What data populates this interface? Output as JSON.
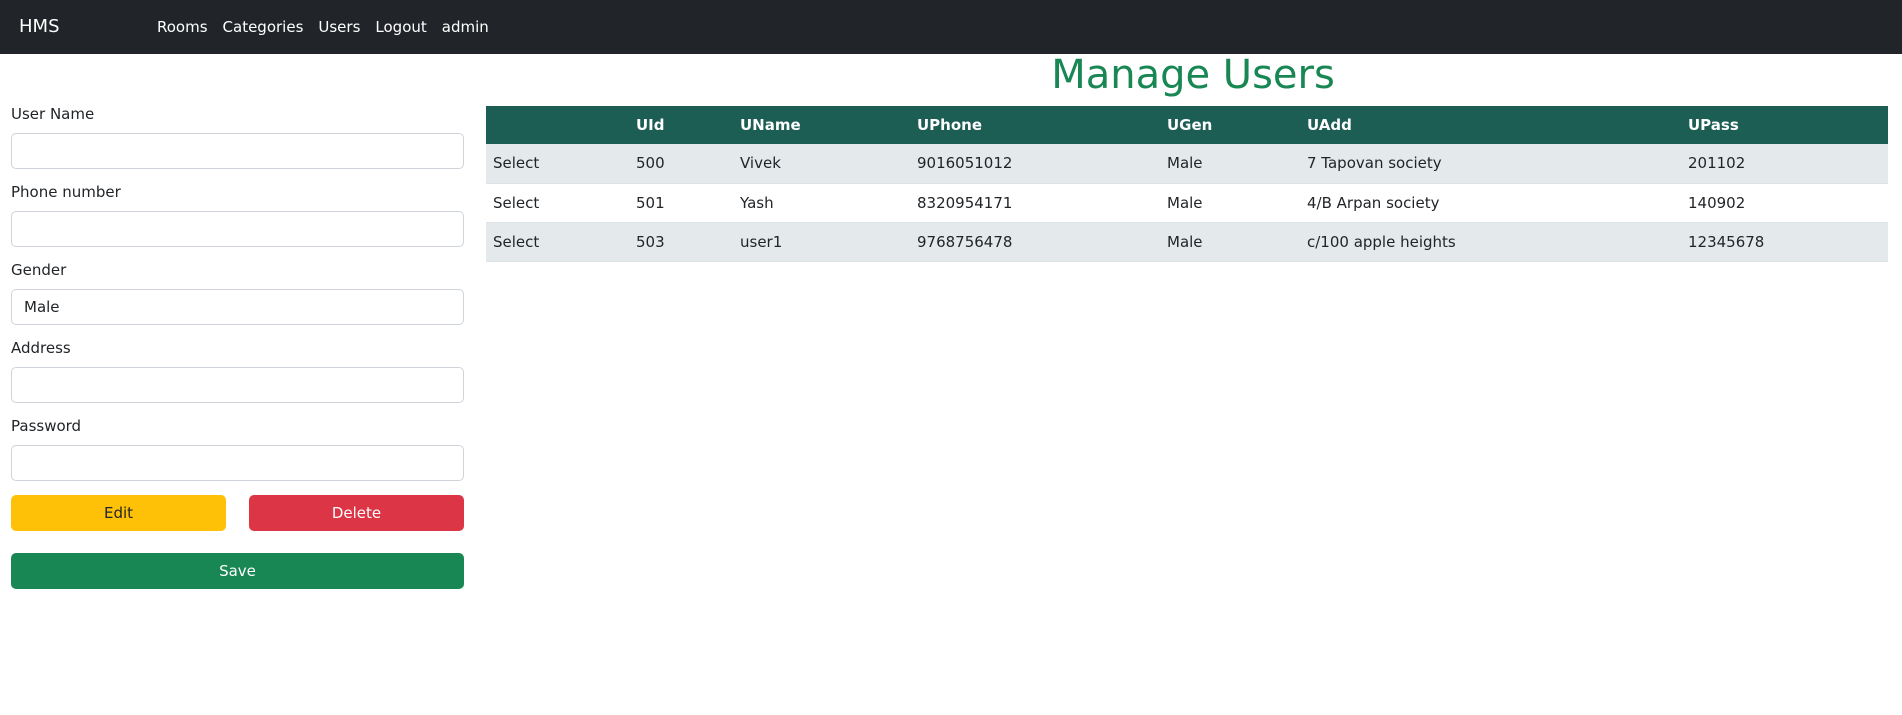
{
  "navbar": {
    "brand": "HMS",
    "links": [
      "Rooms",
      "Categories",
      "Users",
      "Logout",
      "admin"
    ]
  },
  "page": {
    "title": "Manage Users"
  },
  "form": {
    "user_name": {
      "label": "User Name",
      "value": ""
    },
    "phone": {
      "label": "Phone number",
      "value": ""
    },
    "gender": {
      "label": "Gender",
      "value": "Male"
    },
    "address": {
      "label": "Address",
      "value": ""
    },
    "password": {
      "label": "Password",
      "value": ""
    },
    "edit_label": "Edit",
    "delete_label": "Delete",
    "save_label": "Save"
  },
  "table": {
    "headers": [
      "",
      "UId",
      "UName",
      "UPhone",
      "UGen",
      "UAdd",
      "UPass"
    ],
    "rows": [
      [
        "Select",
        "500",
        "Vivek",
        "9016051012",
        "Male",
        "7 Tapovan society",
        "201102"
      ],
      [
        "Select",
        "501",
        "Yash",
        "8320954171",
        "Male",
        "4/B Arpan society",
        "140902"
      ],
      [
        "Select",
        "503",
        "user1",
        "9768756478",
        "Male",
        "c/100 apple heights",
        "12345678"
      ]
    ]
  },
  "colors": {
    "navbar": "#212529",
    "title": "#198754",
    "table_header": "#1c5e54",
    "edit": "#ffc107",
    "delete": "#dc3545",
    "save": "#198754"
  }
}
